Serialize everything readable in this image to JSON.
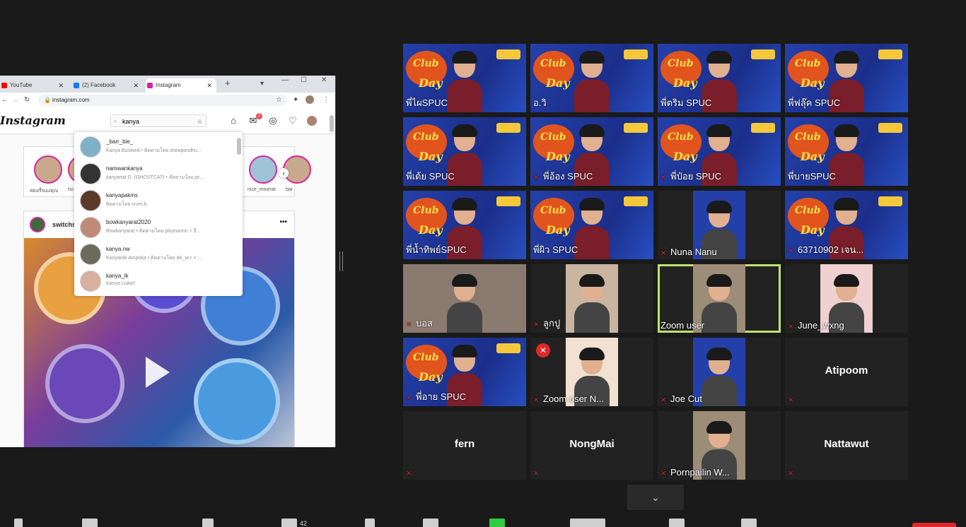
{
  "browser": {
    "tabs": [
      {
        "label": "YouTube",
        "color": "#ff0000"
      },
      {
        "label": "(2) Facebook",
        "color": "#1877f2"
      },
      {
        "label": "Instagram",
        "color": "#d6249f"
      }
    ],
    "url": "instagram.com"
  },
  "instagram": {
    "logo": "Instagram",
    "search_value": "kanya",
    "notification_count": "2",
    "stories": [
      "สตอรี่ของคุณ",
      "ho",
      "nice_miserat",
      "bar"
    ],
    "post_user": "switchsl",
    "search_results": [
      {
        "username": "_barr_bie_",
        "sub": "Kanya Bunloed • ติดตามโดย wwwpondhu..."
      },
      {
        "username": "namwankanya",
        "sub": "kanyanat D. (GHOSTCAT) • ติดตามโดย pc..."
      },
      {
        "username": "kanyapakms",
        "sub": "ติดตามโดย srvm.b"
      },
      {
        "username": "bowkanyarat2020",
        "sub": "Bowkanyarat • ติดตามโดย ploynarinn + อี..."
      },
      {
        "username": "kanya.nw",
        "sub": "Kanyarak Ampoka • ติดตามโดย de_ar.r + ..."
      },
      {
        "username": "kanya_lk",
        "sub": "Kanya Luiket"
      }
    ]
  },
  "gallery": {
    "participants": [
      {
        "name": "พี่ไผSPUC",
        "muted": false
      },
      {
        "name": "อ.วิ",
        "muted": false
      },
      {
        "name": "พี่ตริม SPUC",
        "muted": false
      },
      {
        "name": "พี่ฟลุ๊ค SPUC",
        "muted": false
      },
      {
        "name": "พี่เต้ย SPUC",
        "muted": false
      },
      {
        "name": "พี่อ้อง SPUC",
        "muted": true
      },
      {
        "name": "พี่ป๋อย SPUC",
        "muted": true
      },
      {
        "name": "พี่บายSPUC",
        "muted": false
      },
      {
        "name": "พี่น้ำทิพย์SPUC",
        "muted": false
      },
      {
        "name": "พี่ผิว SPUC",
        "muted": false
      },
      {
        "name": "Nuna Nanu",
        "muted": true
      },
      {
        "name": "63710902 เจน...",
        "muted": true
      },
      {
        "name": "บอส",
        "muted": true
      },
      {
        "name": "ลูกปู",
        "muted": true
      },
      {
        "name": "Zoom user",
        "muted": false
      },
      {
        "name": "June_wxng",
        "muted": true
      },
      {
        "name": "พี่อาย SPUC",
        "muted": true
      },
      {
        "name": "Zoom user N...",
        "muted": true
      },
      {
        "name": "Joe Cut",
        "muted": true
      },
      {
        "name": "Atipoom",
        "muted": true
      },
      {
        "name": "fern",
        "muted": true
      },
      {
        "name": "NongMai",
        "muted": true
      },
      {
        "name": "Pornpailin W...",
        "muted": true
      },
      {
        "name": "Nattawut",
        "muted": true
      }
    ],
    "toolbar_count": "42"
  }
}
